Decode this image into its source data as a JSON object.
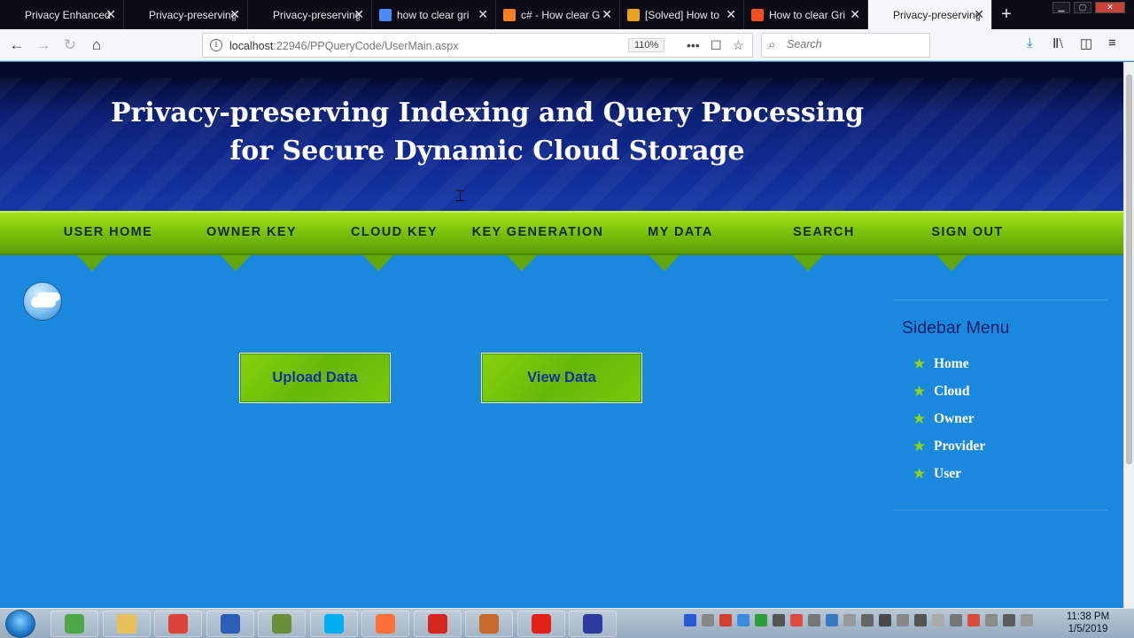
{
  "browser": {
    "tabs": [
      {
        "label": "Privacy Enhanced Lo",
        "icon_color": "#0c0c17",
        "active": false
      },
      {
        "label": "Privacy-preserving In",
        "icon_color": "#0c0c17",
        "active": false
      },
      {
        "label": "Privacy-preserving In",
        "icon_color": "#0c0c17",
        "active": false
      },
      {
        "label": "how to clear gri",
        "icon_color": "#4a8af4",
        "active": false
      },
      {
        "label": "c# - How clear G",
        "icon_color": "#f48024",
        "active": false
      },
      {
        "label": "[Solved] How to",
        "icon_color": "#e8a317",
        "active": false
      },
      {
        "label": "How to clear Gri",
        "icon_color": "#f25022",
        "active": false
      },
      {
        "label": "Privacy-preserving In",
        "icon_color": "#f5f6f7",
        "active": true
      }
    ],
    "close_glyph": "✕",
    "new_tab_glyph": "+",
    "url_host": "localhost",
    "url_rest": ":22946/PPQueryCode/UserMain.aspx",
    "zoom": "110%",
    "search_placeholder": "Search"
  },
  "page": {
    "title": "Privacy-preserving Indexing and Query Processing for Secure Dynamic Cloud Storage",
    "menu": [
      "USER HOME",
      "OWNER KEY",
      "CLOUD KEY",
      "KEY GENERATION",
      "MY DATA",
      "SEARCH",
      "SIGN OUT"
    ],
    "buttons": {
      "upload": "Upload Data",
      "view": "View Data"
    },
    "sidebar": {
      "title": "Sidebar Menu",
      "items": [
        "Home",
        "Cloud",
        "Owner",
        "Provider",
        "User"
      ]
    }
  },
  "taskbar": {
    "apps": [
      "explorer-icon",
      "folder-icon",
      "chrome-icon",
      "word-icon",
      "tools-icon",
      "skype-icon",
      "firefox-icon",
      "acrobat-icon",
      "paint-icon",
      "airtel-icon",
      "vs-icon"
    ],
    "app_colors": [
      "#4fa845",
      "#e8c05a",
      "#db4437",
      "#2b5eb7",
      "#6a8f3a",
      "#00aff0",
      "#ff7139",
      "#d7261d",
      "#c86a2a",
      "#e32119",
      "#2d3c9e"
    ],
    "tray_colors": [
      "#2a5bd7",
      "#888888",
      "#d23f31",
      "#3d8be0",
      "#2c9d3b",
      "#555555",
      "#e04a3f",
      "#777777",
      "#3a78c2",
      "#999999",
      "#666666",
      "#4a4a4a",
      "#888888",
      "#555555",
      "#aaaaaa",
      "#777777",
      "#d84c3e",
      "#8a8a8a",
      "#5c5c5c",
      "#999999"
    ],
    "time": "11:38 PM",
    "date": "1/5/2019"
  }
}
